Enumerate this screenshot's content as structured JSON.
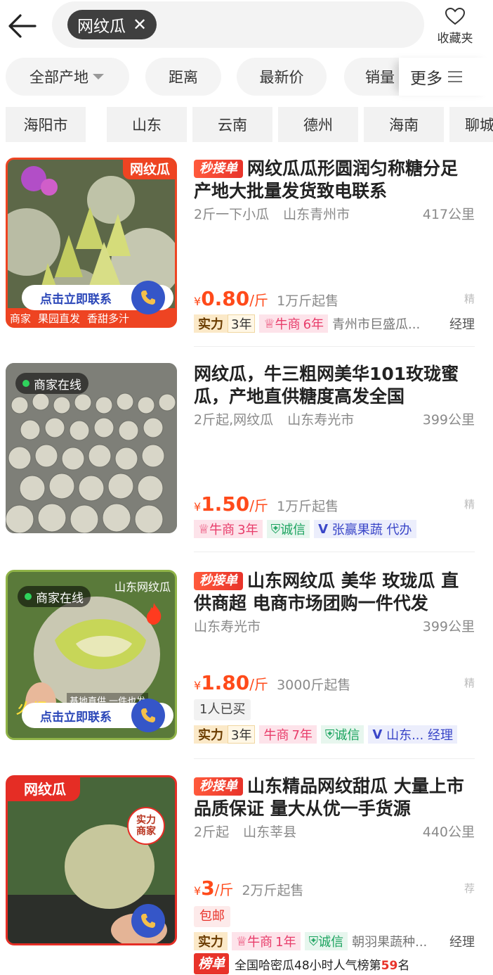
{
  "header": {
    "search_chip": "网纹瓜",
    "favorites_label": "收藏夹"
  },
  "filters": {
    "origin": "全部产地",
    "distance": "距离",
    "latest_price": "最新价",
    "sales": "销量",
    "more": "更多"
  },
  "regions": [
    "海阳市",
    "山东",
    "云南",
    "德州",
    "海南",
    "聊城"
  ],
  "listings": [
    {
      "fast_badge": "秒接单",
      "title": "网纹瓜瓜形圆润匀称糖分足产地大批量发货致电联系",
      "spec": "2斤一下小瓜",
      "location": "山东青州市",
      "distance": "417公里",
      "price_prefix": "¥",
      "price": "0.80",
      "unit": "/斤",
      "min_qty": "1万斤起售",
      "jing": "精",
      "tag_shili": "实力",
      "tag_shili_years": "3年",
      "tag_niu": "牛商",
      "tag_niu_years": "6年",
      "shop": "青州市巨盛瓜...",
      "role": "经理",
      "thumb_corner": "网纹瓜",
      "thumb_contact": "点击立即联系",
      "thumb_bottom_a": "商家",
      "thumb_bottom_b": "果园直发",
      "thumb_bottom_c": "香甜多汁"
    },
    {
      "title": "网纹瓜，牛三粗网美华101玫珑蜜瓜，产地直供糖度高发全国",
      "spec": "2斤起,网纹瓜",
      "location": "山东寿光市",
      "distance": "399公里",
      "price_prefix": "¥",
      "price": "1.50",
      "unit": "/斤",
      "min_qty": "1万斤起售",
      "jing": "精",
      "tag_niu": "牛商",
      "tag_niu_years": "3年",
      "tag_chengxin": "诚信",
      "tag_v": "张赢果蔬 代办",
      "thumb_online": "商家在线"
    },
    {
      "fast_badge": "秒接单",
      "title": "山东网纹瓜 美华 玫珑瓜 直供商超 电商市场团购一件代发",
      "location": "山东寿光市",
      "distance": "399公里",
      "price_prefix": "¥",
      "price": "1.80",
      "unit": "/斤",
      "min_qty": "3000斤起售",
      "jing": "精",
      "bought": "1人已买",
      "tag_shili": "实力",
      "tag_shili_years": "3年",
      "tag_niu": "牛商",
      "tag_niu_years": "7年",
      "tag_chengxin": "诚信",
      "tag_v": "山东...",
      "role": "经理",
      "thumb_online": "商家在线",
      "thumb_corner": "山东网纹瓜",
      "thumb_direct": "基地直供 一件也发",
      "thumb_hot": "火爆",
      "thumb_contact": "点击立即联系"
    },
    {
      "fast_badge": "秒接单",
      "title": "山东精品网纹甜瓜 大量上市 品质保证 量大从优一手货源",
      "spec": "2斤起",
      "location": "山东莘县",
      "distance": "440公里",
      "price_prefix": "¥",
      "price": "3",
      "unit": "/斤",
      "min_qty": "2万斤起售",
      "jing": "荐",
      "baoyou": "包邮",
      "tag_shili": "实力",
      "tag_niu": "牛商",
      "tag_niu_years": "1年",
      "tag_chengxin": "诚信",
      "shop": "朝羽果蔬种...",
      "role": "经理",
      "bangdan_label": "榜单",
      "bangdan_text": "全国哈密瓜48小时人气榜第",
      "bangdan_rank": "59",
      "bangdan_suffix": "名",
      "thumb_corner": "网纹瓜",
      "thumb_stamp_a": "实力",
      "thumb_stamp_b": "商家"
    }
  ],
  "colors": {
    "accent": "#ff4a1a",
    "brand_red": "#e8332a",
    "contact_blue": "#3556c8"
  }
}
